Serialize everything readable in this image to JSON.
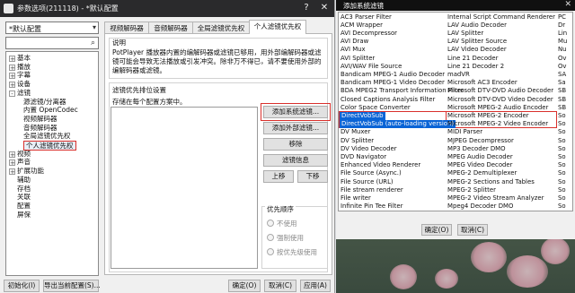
{
  "main_window": {
    "title": "参数选项(211118) - *默认配置",
    "preset": "*默认配置",
    "tree": [
      {
        "label": "基本",
        "expander": "+",
        "level": 0
      },
      {
        "label": "播放",
        "expander": "+",
        "level": 0
      },
      {
        "label": "字幕",
        "expander": "+",
        "level": 0
      },
      {
        "label": "设备",
        "expander": "+",
        "level": 0
      },
      {
        "label": "滤镜",
        "expander": "-",
        "level": 0
      },
      {
        "label": "源滤镜/分离器",
        "expander": "",
        "level": 1
      },
      {
        "label": "内置 OpenCodec",
        "expander": "",
        "level": 1
      },
      {
        "label": "视频解码器",
        "expander": "",
        "level": 1
      },
      {
        "label": "音频解码器",
        "expander": "",
        "level": 1
      },
      {
        "label": "全局滤镜优先权",
        "expander": "",
        "level": 1
      },
      {
        "label": "个人滤镜优先权",
        "expander": "",
        "level": 1,
        "selected": true
      },
      {
        "label": "视频",
        "expander": "+",
        "level": 0
      },
      {
        "label": "声音",
        "expander": "+",
        "level": 0
      },
      {
        "label": "扩展功能",
        "expander": "+",
        "level": 0
      },
      {
        "label": "辅助",
        "expander": "",
        "level": 0
      },
      {
        "label": "存档",
        "expander": "",
        "level": 0
      },
      {
        "label": "关联",
        "expander": "",
        "level": 0
      },
      {
        "label": "配置",
        "expander": "",
        "level": 0
      },
      {
        "label": "屏保",
        "expander": "",
        "level": 0
      }
    ],
    "tabs": [
      "视频解码器",
      "音频解码器",
      "全局滤镜优先权",
      "个人滤镜优先权"
    ],
    "active_tab": 3,
    "section_desc_title": "说明",
    "desc_text": "PotPlayer 播放器内置的编解码器或滤镜已够用，用外部编解码器或滤镜可能会导致无法播放或引发冲突。除非万不得已，请不要使用外部的编解码器或滤镜。",
    "priority_group": "滤镜优先排位设置",
    "priority_hint": "存储在每个配置方案中。",
    "buttons": {
      "add_system": "添加系统滤镜...",
      "add_external": "添加外部滤镜...",
      "remove": "移除",
      "info": "滤镜信息",
      "up": "上移",
      "down": "下移"
    },
    "order_group": "优先顺序",
    "order_options": [
      "不使用",
      "强制使用",
      "按优先级使用"
    ],
    "bottom": {
      "init": "初始化(I)",
      "export": "导出当前配置(S)...",
      "ok": "确定(O)",
      "cancel": "取消(C)",
      "apply": "应用(A)"
    }
  },
  "filter_dialog": {
    "title": "添加系统滤镜",
    "rows": [
      [
        "AC3 Parser Filter",
        "Internal Script Command Renderer",
        "PC"
      ],
      [
        "ACM Wrapper",
        "LAV Audio Decoder",
        "Dr"
      ],
      [
        "AVI Decompressor",
        "LAV Splitter",
        "Lin"
      ],
      [
        "AVI Draw",
        "LAV Splitter Source",
        "Mu"
      ],
      [
        "AVI Mux",
        "LAV Video Decoder",
        "Nu"
      ],
      [
        "AVI Splitter",
        "Line 21 Decoder",
        "Ov"
      ],
      [
        "AVI/WAV File Source",
        "Line 21 Decoder 2",
        "Ov"
      ],
      [
        "Bandicam MPEG-1 Audio Decoder",
        "madVR",
        "SA"
      ],
      [
        "Bandicam MPEG-1 Video Decoder",
        "Microsoft AC3 Encoder",
        "Sa"
      ],
      [
        "BDA MPEG2 Transport Information Filter",
        "Microsoft DTV-DVD Audio Decoder",
        "SB"
      ],
      [
        "Closed Captions Analysis Filter",
        "Microsoft DTV-DVD Video Decoder",
        "SB"
      ],
      [
        "Color Space Converter",
        "Microsoft MPEG-2 Audio Encoder",
        "SB"
      ],
      [
        "DirectVobSub",
        "Microsoft MPEG-2 Encoder",
        "So"
      ],
      [
        "DirectVobSub (auto-loading version)",
        "Microsoft MPEG-2 Video Encoder",
        "So"
      ],
      [
        "DV Muxer",
        "MIDI Parser",
        "So"
      ],
      [
        "DV Splitter",
        "MJPEG Decompressor",
        "So"
      ],
      [
        "DV Video Decoder",
        "MP3 Decoder DMO",
        "So"
      ],
      [
        "DVD Navigator",
        "MPEG Audio Decoder",
        "So"
      ],
      [
        "Enhanced Video Renderer",
        "MPEG Video Decoder",
        "So"
      ],
      [
        "File Source (Async.)",
        "MPEG-2 Demultiplexer",
        "So"
      ],
      [
        "File Source (URL)",
        "MPEG-2 Sections and Tables",
        "So"
      ],
      [
        "File stream renderer",
        "MPEG-2 Splitter",
        "So"
      ],
      [
        "File writer",
        "MPEG-2 Video Stream Analyzer",
        "So"
      ],
      [
        "Infinite Pin Tee Filter",
        "Mpeg4 Decoder DMO",
        "So"
      ]
    ],
    "selected_rows": [
      12,
      13
    ],
    "ok": "确定(O)",
    "cancel": "取消(C)"
  },
  "colors": {
    "highlight_red": "#d9302c",
    "selection_blue": "#0a64d6",
    "titlebar": "#2a2a2c"
  }
}
